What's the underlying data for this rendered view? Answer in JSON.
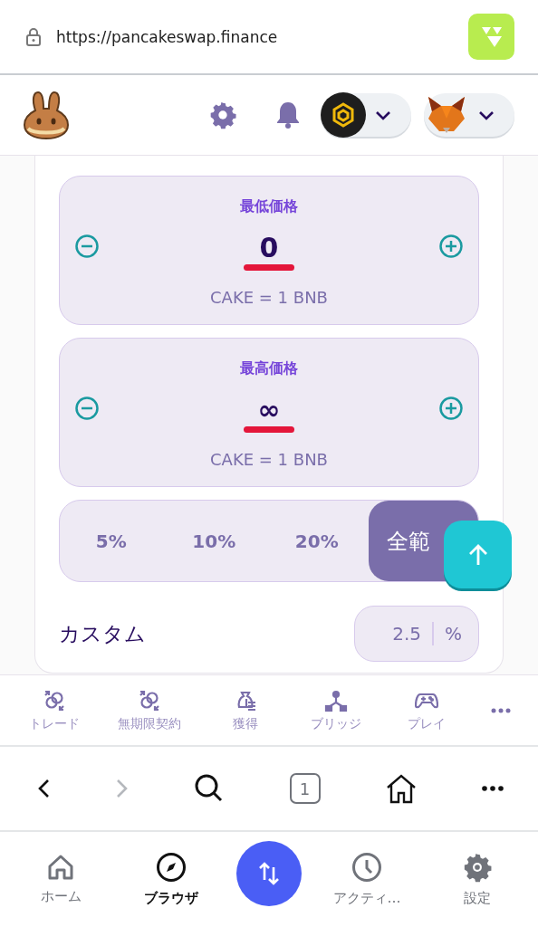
{
  "browser": {
    "url": "https://pancakeswap.finance"
  },
  "price_cards": [
    {
      "label": "最低価格",
      "value": "0",
      "unit": "CAKE = 1 BNB"
    },
    {
      "label": "最高価格",
      "value": "∞",
      "unit": "CAKE = 1 BNB"
    }
  ],
  "range_options": [
    {
      "label": "5%",
      "selected": false
    },
    {
      "label": "10%",
      "selected": false
    },
    {
      "label": "20%",
      "selected": false
    },
    {
      "label": "全範",
      "selected": true
    }
  ],
  "custom": {
    "label": "カスタム",
    "value": "2.5",
    "unit": "%"
  },
  "nav": [
    {
      "label": "トレード",
      "kind": "swap"
    },
    {
      "label": "無期限契約",
      "kind": "swap"
    },
    {
      "label": "獲得",
      "kind": "money"
    },
    {
      "label": "ブリッジ",
      "kind": "bridge"
    },
    {
      "label": "プレイ",
      "kind": "game"
    }
  ],
  "toolbar": {
    "tab_count": "1"
  },
  "tabs": [
    {
      "label": "ホーム",
      "kind": "home",
      "selected": false
    },
    {
      "label": "ブラウザ",
      "kind": "compass",
      "selected": true
    },
    {
      "kind": "action"
    },
    {
      "label": "アクティ…",
      "kind": "clock",
      "selected": false
    },
    {
      "label": "設定",
      "kind": "gear",
      "selected": false
    }
  ]
}
